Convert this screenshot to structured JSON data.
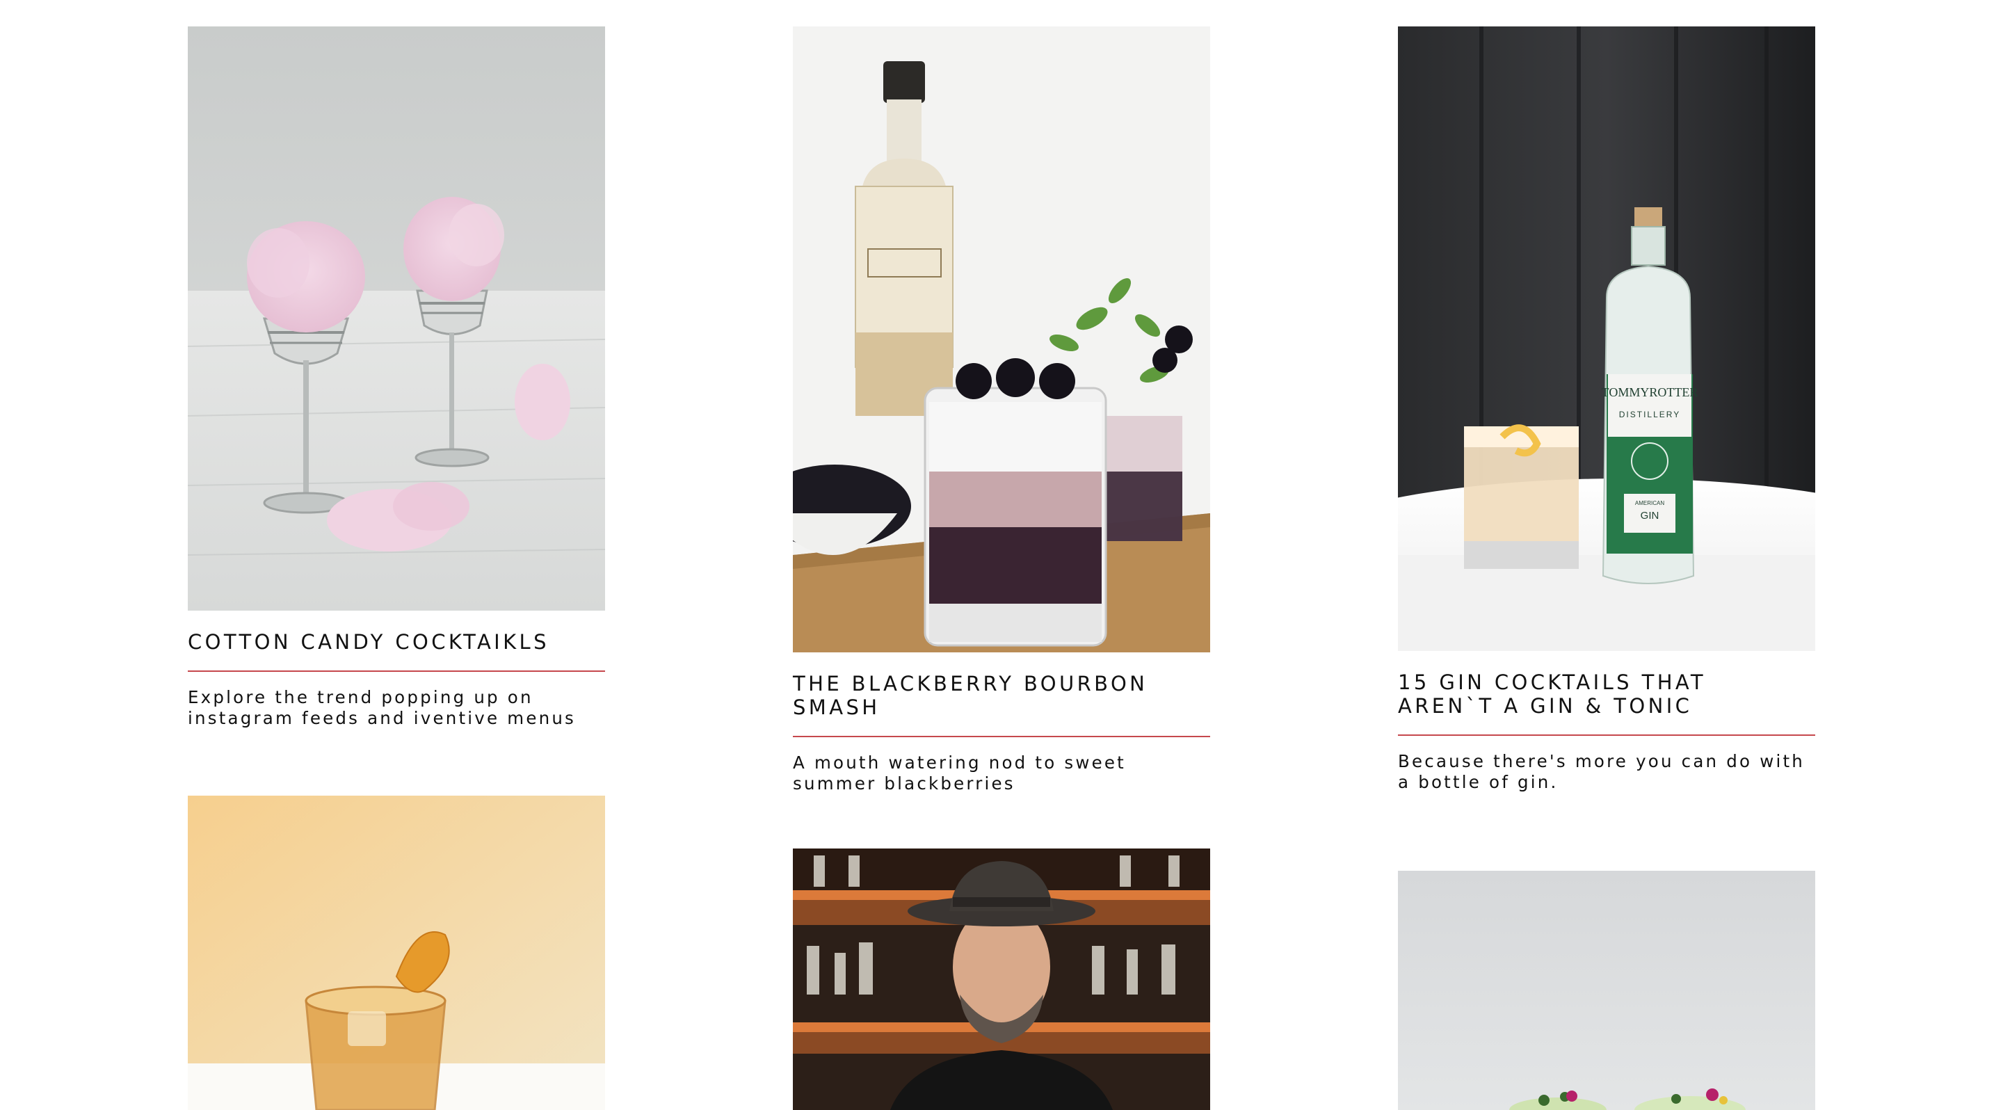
{
  "cards": [
    {
      "title": "COTTON CANDY COCKTAIKLS",
      "description": "Explore the trend popping up on instagram feeds and iventive menus",
      "image": "cotton-candy-cocktails-photo"
    },
    {
      "title": "THE BLACKBERRY BOURBON SMASH",
      "description": "A mouth watering nod to sweet summer blackberries",
      "image": "blackberry-bourbon-smash-photo"
    },
    {
      "title": "15 GIN COCKTAILS THAT\nAREN`T A GIN & TONIC",
      "description": "Because there's more you can do with a bottle of gin.",
      "image": "gin-cocktails-photo",
      "bottle_label": {
        "brand": "TOMMYROTTER",
        "sub": "DISTILLERY",
        "kind_small": "AMERICAN",
        "kind": "GIN"
      }
    },
    {
      "image": "old-fashioned-orange-twist-photo"
    },
    {
      "image": "bartender-in-hat-photo"
    },
    {
      "image": "green-cocktails-flowers-photo"
    }
  ],
  "colors": {
    "divider": "#c6484d",
    "background": "#ffffff",
    "text": "#111111"
  }
}
